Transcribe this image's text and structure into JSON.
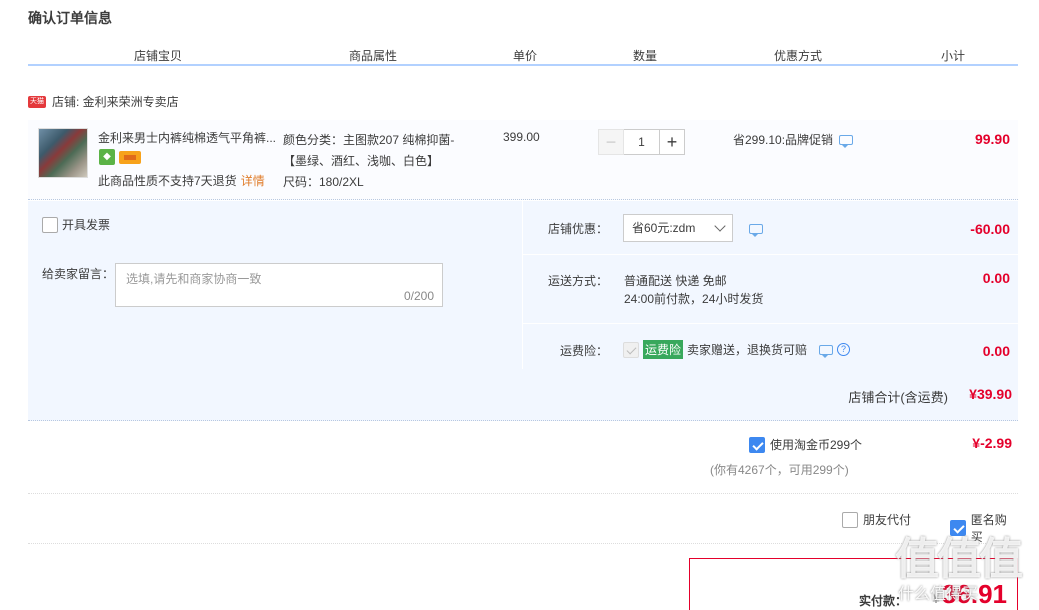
{
  "page_title": "确认订单信息",
  "columns": [
    "店铺宝贝",
    "商品属性",
    "单价",
    "数量",
    "优惠方式",
    "小计"
  ],
  "shop": {
    "badge": "天猫",
    "label": "店铺: 金利来荣洲专卖店"
  },
  "item": {
    "name": "金利来男士内裤纯棉透气平角裤...",
    "no_return": "此商品性质不支持7天退货",
    "detail_link": "详情",
    "attr_line1": "颜色分类：主图款207 纯棉抑菌-",
    "attr_line2": "【墨绿、酒红、浅咖、白色】",
    "attr_line3": "尺码：180/2XL",
    "unit_price": "399.00",
    "quantity": "1",
    "promo": "省299.10:品牌促销",
    "subtotal": "99.90"
  },
  "invoice_label": "开具发票",
  "message": {
    "label": "给卖家留言：",
    "placeholder": "选填,请先和商家协商一致",
    "counter": "0/200"
  },
  "shop_discount": {
    "label": "店铺优惠：",
    "selected": "省60元:zdm",
    "amount": "-60.00"
  },
  "shipping": {
    "label": "运送方式：",
    "line1": "普通配送 快递 免邮",
    "line2": "24:00前付款，24小时发货",
    "amount": "0.00"
  },
  "insurance": {
    "label": "运费险：",
    "tag": "运费险",
    "text": "卖家赠送，退换货可赔",
    "help": "?",
    "amount": "0.00"
  },
  "shop_total": {
    "label": "店铺合计(含运费)",
    "amount": "¥39.90"
  },
  "coins": {
    "label": "使用淘金币299个",
    "sub": "(你有4267个，可用299个)",
    "amount": "¥-2.99"
  },
  "options": {
    "friend_pay": "朋友代付",
    "anonymous": "匿名购买"
  },
  "payment": {
    "label": "实付款：",
    "yen": "¥",
    "amount": "36.91"
  },
  "watermark": {
    "main": "值值值",
    "sub": "什么值得买"
  },
  "colors": {
    "accent": "#3d88f0",
    "price_red": "#e4002b",
    "panel_bg": "#f2f7ff"
  }
}
